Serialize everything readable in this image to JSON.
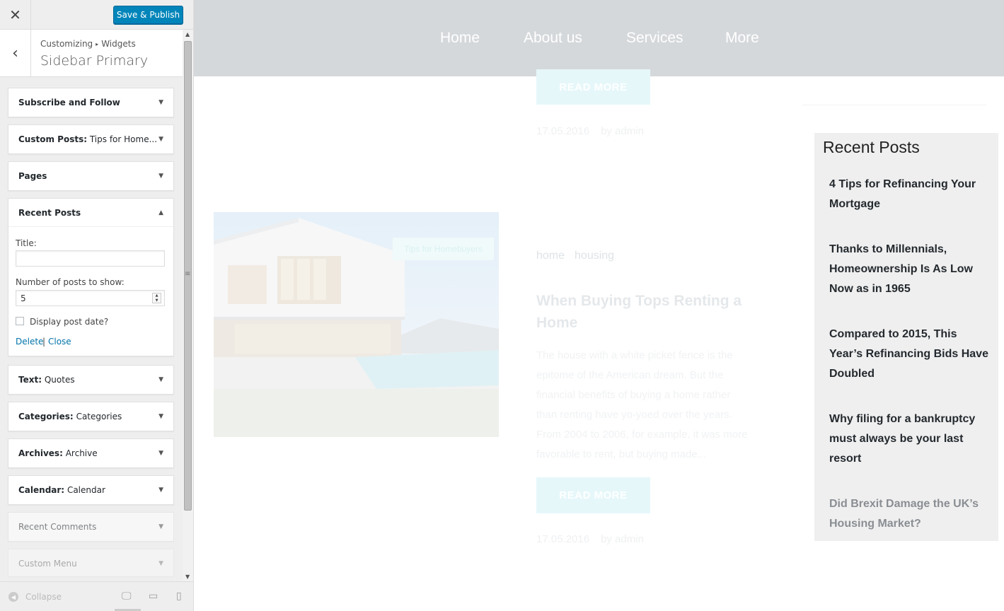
{
  "customizer": {
    "close_icon": "close-icon",
    "save_label": "Save & Publish",
    "breadcrumb": {
      "root": "Customizing",
      "current": "Widgets"
    },
    "section_title": "Sidebar Primary",
    "widgets": [
      {
        "name": "Subscribe and Follow",
        "subtitle": ""
      },
      {
        "name": "Custom Posts:",
        "subtitle": "Tips for Home..."
      },
      {
        "name": "Pages",
        "subtitle": ""
      },
      {
        "name": "Recent Posts",
        "subtitle": ""
      },
      {
        "name": "Text:",
        "subtitle": "Quotes"
      },
      {
        "name": "Categories:",
        "subtitle": "Categories"
      },
      {
        "name": "Archives:",
        "subtitle": "Archive"
      },
      {
        "name": "Calendar:",
        "subtitle": "Calendar"
      },
      {
        "name": "Recent Comments",
        "subtitle": ""
      },
      {
        "name": "Custom Menu",
        "subtitle": ""
      }
    ],
    "recent_posts_form": {
      "title_label": "Title:",
      "title_value": "",
      "number_label": "Number of posts to show:",
      "number_value": "5",
      "display_date_label": "Display post date?",
      "display_date_checked": false,
      "delete_label": "Delete",
      "separator": "|",
      "close_label": "Close"
    },
    "footer": {
      "collapse_label": "Collapse"
    },
    "colors": {
      "primary_button": "#0085ba",
      "link": "#0073aa"
    }
  },
  "preview": {
    "nav": [
      "Home",
      "About us",
      "Services",
      "More"
    ],
    "read_more_label": "READ MORE",
    "post_meta": {
      "date": "17.05.2016",
      "author": "by admin"
    },
    "post": {
      "badge": "Tips for Homebuyers",
      "tags": [
        "home",
        "housing"
      ],
      "title": "When Buying Tops Renting a Home",
      "excerpt": "The house with a white picket fence is the epitome of the American dream. But the financial benefits of buying a home rather than renting have yo-yoed over the years. From 2004 to 2006, for example, it was more favorable to rent, but buying made..."
    },
    "recent_posts": {
      "title": "Recent Posts",
      "items": [
        "4 Tips for Refinancing Your Mortgage",
        "Thanks to Millennials, Homeownership Is As Low Now as in 1965",
        "Compared to 2015, This Year’s Refinancing Bids Have Doubled",
        "Why filing for a bankruptcy must always be your last resort",
        "Did Brexit Damage the UK’s Housing Market?"
      ]
    }
  }
}
